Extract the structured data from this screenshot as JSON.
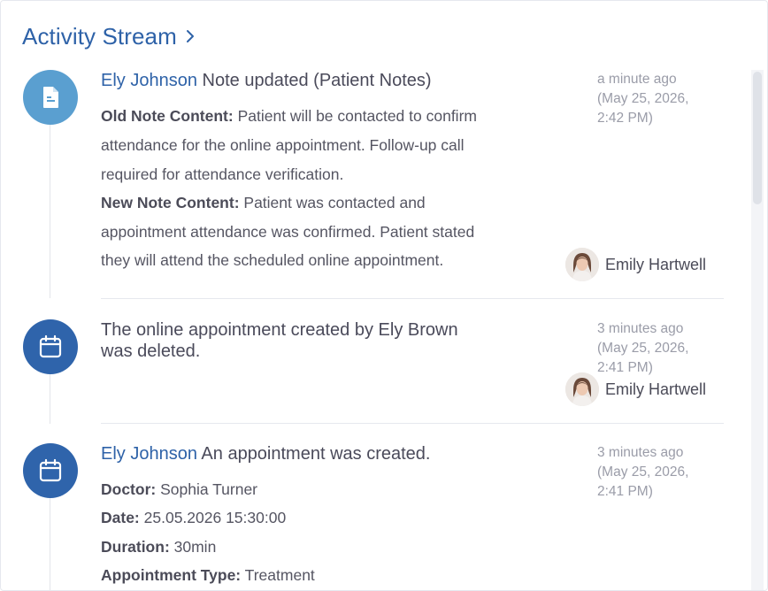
{
  "header": {
    "title": "Activity Stream"
  },
  "entries": [
    {
      "actor": "Ely Johnson",
      "title": "Note updated (Patient Notes)",
      "time_relative": "a minute ago",
      "time_line1": "(May 25, 2026,",
      "time_line2": "2:42 PM)",
      "lines": [
        {
          "key": "Old Note Content:",
          "value": " Patient will be contacted to confirm"
        },
        {
          "key": "",
          "value": "attendance for the online appointment. Follow-up call"
        },
        {
          "key": "",
          "value": "required for attendance verification."
        },
        {
          "key": "New Note Content:",
          "value": " Patient was contacted and"
        },
        {
          "key": "",
          "value": "appointment attendance was confirmed. Patient stated"
        },
        {
          "key": "",
          "value": "they will attend the scheduled online appointment."
        }
      ],
      "user": "Emily Hartwell"
    },
    {
      "title_line1": "The online appointment created by Ely Brown",
      "title_line2": "was deleted.",
      "time_relative": "3 minutes ago",
      "time_line1": "(May 25, 2026,",
      "time_line2": "2:41 PM)",
      "user": "Emily Hartwell"
    },
    {
      "actor": "Ely Johnson",
      "title": "An appointment was created.",
      "time_relative": "3 minutes ago",
      "time_line1": "(May 25, 2026,",
      "time_line2": "2:41 PM)",
      "lines": [
        {
          "key": "Doctor:",
          "value": " Sophia Turner"
        },
        {
          "key": "Date:",
          "value": " 25.05.2026 15:30:00"
        },
        {
          "key": "Duration:",
          "value": " 30min"
        },
        {
          "key": "Appointment Type:",
          "value": " Treatment"
        }
      ]
    }
  ],
  "colors": {
    "accent": "#2e62a8",
    "note_icon": "#5a9fd0",
    "calendar_icon": "#2f64ab"
  },
  "icons": {
    "note": "document-icon",
    "calendar": "calendar-icon",
    "chevron": "chevron-right-icon"
  }
}
